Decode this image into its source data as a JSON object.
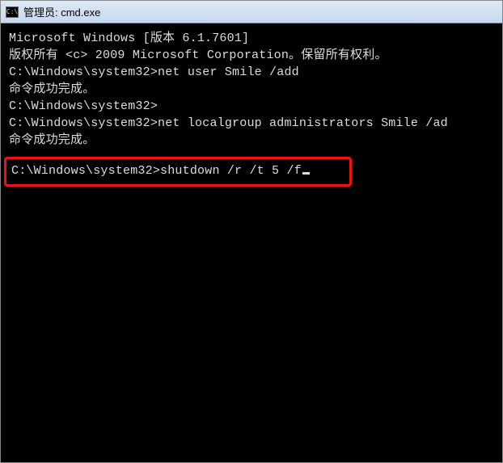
{
  "titlebar": {
    "icon_label": "C:\\",
    "title": "管理员: cmd.exe"
  },
  "terminal": {
    "line1": "Microsoft Windows [版本 6.1.7601]",
    "line2": "版权所有 <c> 2009 Microsoft Corporation。保留所有权利。",
    "blank1": "",
    "line3": "C:\\Windows\\system32>net user Smile /add",
    "line4": "命令成功完成。",
    "blank2": "",
    "blank3": "",
    "line5": "C:\\Windows\\system32>",
    "line6": "C:\\Windows\\system32>net localgroup administrators Smile /ad",
    "line7": "命令成功完成。",
    "blank4": "",
    "highlight_prompt": "C:\\Windows\\system32>",
    "highlight_command": "shutdown /r /t 5 /f"
  }
}
